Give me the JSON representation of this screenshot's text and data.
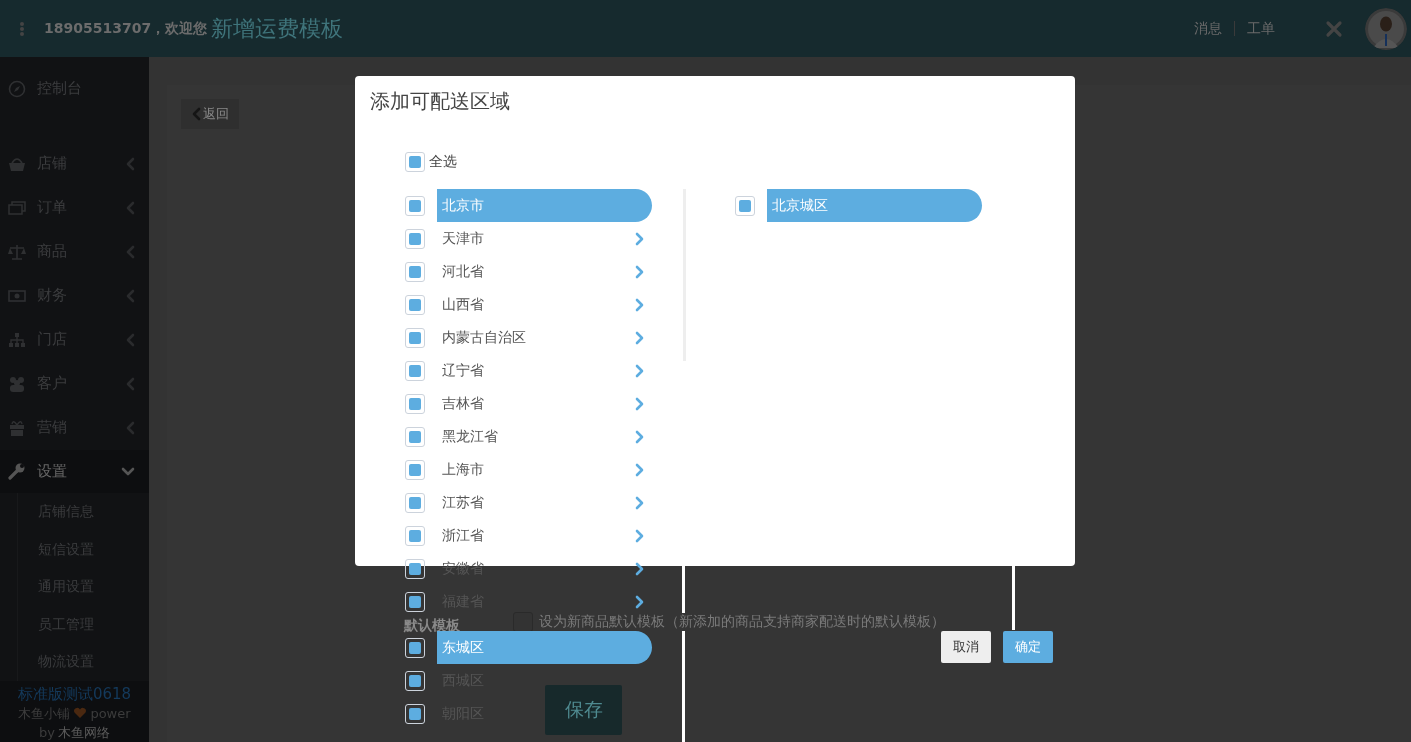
{
  "header": {
    "greeting": "18905513707，欢迎您",
    "page_title": "新增运费模板",
    "links": [
      "消息",
      "工单"
    ]
  },
  "sidebar": {
    "items": [
      {
        "label": "控制台"
      },
      {
        "label": "店铺",
        "expanded": false
      },
      {
        "label": "订单",
        "expanded": false
      },
      {
        "label": "商品",
        "expanded": false
      },
      {
        "label": "财务",
        "expanded": false
      },
      {
        "label": "门店",
        "expanded": false
      },
      {
        "label": "客户",
        "expanded": false
      },
      {
        "label": "营销",
        "expanded": false
      },
      {
        "label": "设置",
        "expanded": true,
        "children": [
          "店铺信息",
          "短信设置",
          "通用设置",
          "员工管理",
          "物流设置"
        ]
      }
    ],
    "footer": {
      "shop": "标准版测试0618",
      "brand": "木鱼小铺",
      "power": "power",
      "by": "by",
      "company": "木鱼网络"
    }
  },
  "main": {
    "back_button": "返回",
    "default_label": "默认模板",
    "default_checkbox": {
      "label": "设为新商品默认模板（新添加的商品支持商家配送时的默认模板）",
      "checked": false
    },
    "save_button": "保存"
  },
  "modal": {
    "title": "添加可配送区域",
    "select_all": {
      "label": "全选",
      "checked": true
    },
    "provinces": [
      {
        "name": "北京市",
        "checked": true,
        "selected": true
      },
      {
        "name": "天津市",
        "checked": true,
        "selected": false
      },
      {
        "name": "河北省",
        "checked": true,
        "selected": false
      },
      {
        "name": "山西省",
        "checked": true,
        "selected": false
      },
      {
        "name": "内蒙古自治区",
        "checked": true,
        "selected": false
      },
      {
        "name": "辽宁省",
        "checked": true,
        "selected": false
      },
      {
        "name": "吉林省",
        "checked": true,
        "selected": false
      },
      {
        "name": "黑龙江省",
        "checked": true,
        "selected": false
      },
      {
        "name": "上海市",
        "checked": true,
        "selected": false
      },
      {
        "name": "江苏省",
        "checked": true,
        "selected": false
      },
      {
        "name": "浙江省",
        "checked": true,
        "selected": false
      },
      {
        "name": "安徽省",
        "checked": true,
        "selected": false
      },
      {
        "name": "福建省",
        "checked": true,
        "selected": false
      }
    ],
    "cities": [
      {
        "name": "北京城区",
        "checked": true,
        "selected": true
      }
    ],
    "districts": [
      {
        "name": "东城区",
        "checked": true,
        "selected": true
      },
      {
        "name": "西城区",
        "checked": true,
        "selected": false
      },
      {
        "name": "朝阳区",
        "checked": true,
        "selected": false
      }
    ],
    "buttons": [
      "取消",
      "确定"
    ]
  }
}
